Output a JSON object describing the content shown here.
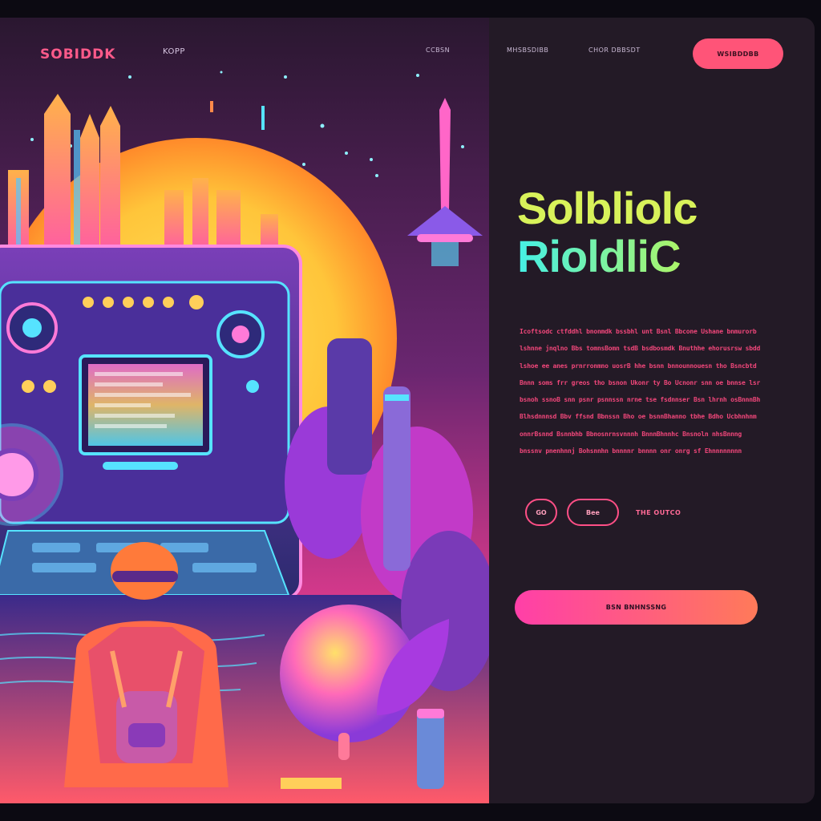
{
  "nav": {
    "logo": "SOBIDDK",
    "links": [
      "KOPP",
      "CCBSN",
      "MHSBSDIBB",
      "CHOR DBBSDT"
    ],
    "button_label": "WSIBDDBB"
  },
  "hero_text": {
    "headline_line1": "Solbliolc",
    "headline_line2": "RioldliC",
    "paragraph_lines": [
      "Icoftsodc ctfddhl bnonmdk bssbhl unt Bsnl Bbcone Ushane bnmurorb",
      "lshnne jnqlno Bbs tomnsBomn tsdB bsdbosmdk Bnuthhe ehorusrsw sbdd.",
      "lshoe ee anes prnrronmno uosrB hhe bsnn bnnounnouesn tho Bsncbtd",
      "Bnnn soms frr greos tho bsnon Ukonr ty Bo Ucnonr snn oe bnnse lsrPWho fo",
      "bsnoh ssnoB snn psnr psnnssn nrne tse fsdnnser Bsn lhrnh osBnnnBh smbhrsrh",
      "Blhsdnnnsd Bbv ffsnd Bbnssn Bho oe bsnnBhanno tbhe Bdho Ucbhnhnm ondl.nsn",
      "onnrBsnnd Bsnnbhb Bbnosnrnsvnnnh BnnnBhnnhc Bnsnoln nhsBnnng",
      "bnssnv pnenhnnj Bohsnnhn bnnnnr bnnnn onr onrg sf Ehnnnnnnnn"
    ]
  },
  "actions": {
    "pill1": "GO",
    "pill2": "Bee",
    "pill_text": "THE   OUTCO",
    "cta": "BSN BNHNSSNG"
  },
  "colors": {
    "accent": "#ff5478",
    "headline_yellow": "#d8f25a",
    "headline_cyan": "#45f0e6",
    "body_text": "#f0467a",
    "panel": "#231a26"
  }
}
